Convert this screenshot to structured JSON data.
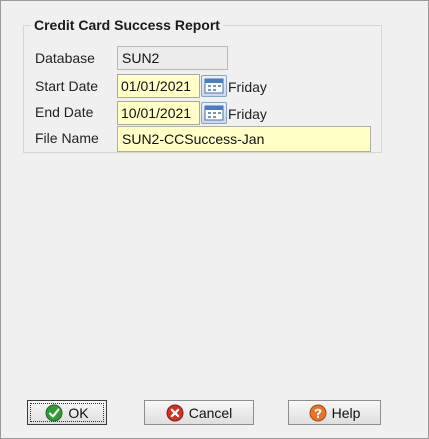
{
  "form": {
    "title": "Credit Card Success Report",
    "database_label": "Database",
    "database_value": "SUN2",
    "start_date_label": "Start Date",
    "start_date_value": "01/01/2021",
    "start_day": "Friday",
    "end_date_label": "End Date",
    "end_date_value": "10/01/2021",
    "end_day": "Friday",
    "file_name_label": "File Name",
    "file_name_value": "SUN2-CCSuccess-Jan"
  },
  "buttons": {
    "ok_label": "OK",
    "cancel_label": "Cancel",
    "help_label": "Help"
  },
  "icons": {
    "ok": "check-circle-icon",
    "cancel": "cancel-x-icon",
    "help": "help-question-icon",
    "calendar": "calendar-icon"
  },
  "colors": {
    "field_highlight": "#ffffc6",
    "ok_icon": "#2e9c2e",
    "cancel_icon": "#d03025",
    "help_icon": "#e8742a"
  }
}
